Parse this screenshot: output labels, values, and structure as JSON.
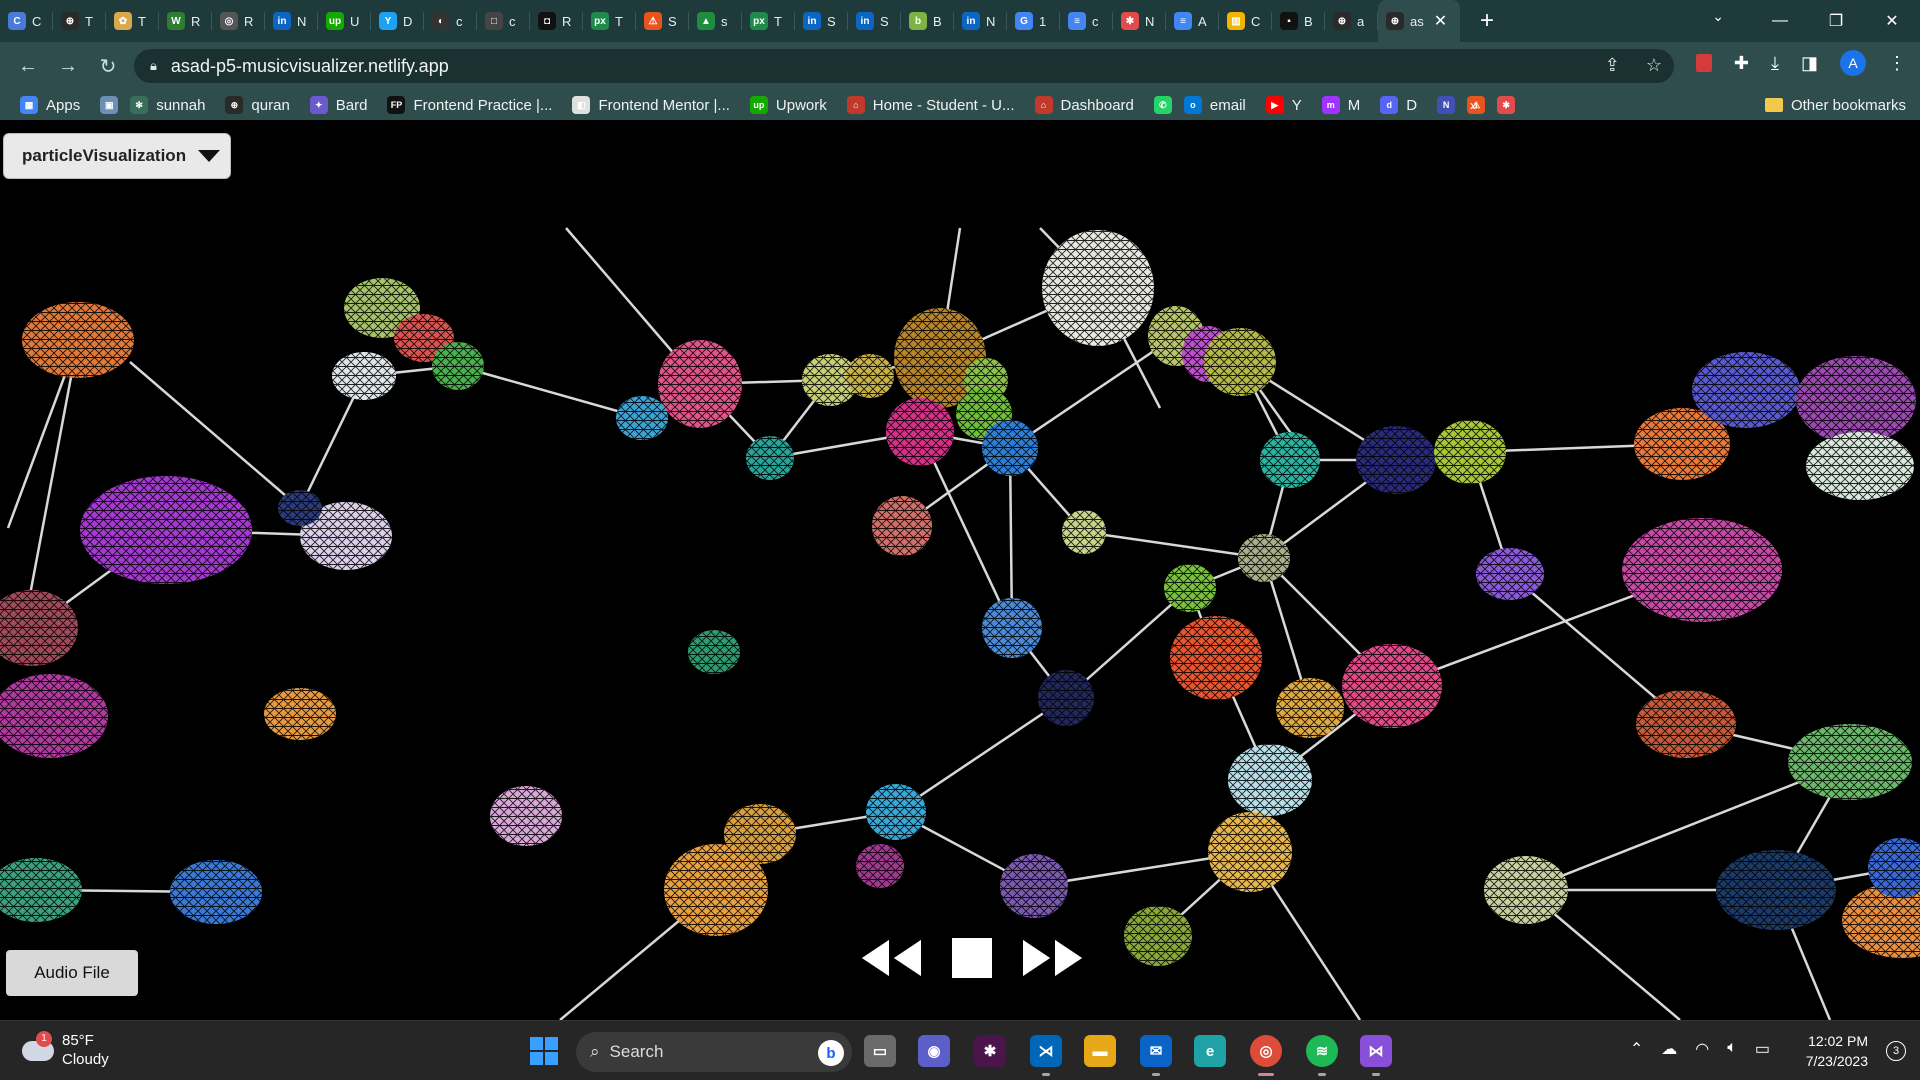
{
  "browser": {
    "tabs": [
      {
        "icon": "C",
        "label": "C",
        "color": "#4a7bd9"
      },
      {
        "icon": "⊕",
        "label": "T",
        "color": "#2a2a2a"
      },
      {
        "icon": "✿",
        "label": "T",
        "color": "#d9a84a"
      },
      {
        "icon": "W",
        "label": "R",
        "color": "#2e7d32"
      },
      {
        "icon": "◎",
        "label": "R",
        "color": "#555"
      },
      {
        "icon": "in",
        "label": "N",
        "color": "#0a66c2"
      },
      {
        "icon": "up",
        "label": "U",
        "color": "#14a800"
      },
      {
        "icon": "Y",
        "label": "D",
        "color": "#1da1f2"
      },
      {
        "icon": "◐",
        "label": "c",
        "color": "#333"
      },
      {
        "icon": "□",
        "label": "c",
        "color": "#444"
      },
      {
        "icon": "◘",
        "label": "R",
        "color": "#111"
      },
      {
        "icon": "px",
        "label": "T",
        "color": "#1f8a4c"
      },
      {
        "icon": "⚠",
        "label": "S",
        "color": "#e8541c"
      },
      {
        "icon": "▲",
        "label": "s",
        "color": "#1e8e3e"
      },
      {
        "icon": "px",
        "label": "T",
        "color": "#1f8a4c"
      },
      {
        "icon": "in",
        "label": "S",
        "color": "#0a66c2"
      },
      {
        "icon": "in",
        "label": "S",
        "color": "#0a66c2"
      },
      {
        "icon": "b",
        "label": "B",
        "color": "#7cb342"
      },
      {
        "icon": "in",
        "label": "N",
        "color": "#0a66c2"
      },
      {
        "icon": "G",
        "label": "1",
        "color": "#4285f4"
      },
      {
        "icon": "≡",
        "label": "c",
        "color": "#4285f4"
      },
      {
        "icon": "✱",
        "label": "N",
        "color": "#e24b4b"
      },
      {
        "icon": "≡",
        "label": "A",
        "color": "#4285f4"
      },
      {
        "icon": "▥",
        "label": "C",
        "color": "#f2b400"
      },
      {
        "icon": "▪",
        "label": "B",
        "color": "#111"
      },
      {
        "icon": "⊕",
        "label": "a",
        "color": "#2a2a2a"
      }
    ],
    "active_tab": {
      "icon": "⊕",
      "label": "as",
      "color": "#2a2a2a"
    },
    "url": "asad-p5-musicvisualizer.netlify.app",
    "profile_initial": "A"
  },
  "bookmarks": {
    "items": [
      {
        "icon": "▦",
        "label": "Apps",
        "color": "#4285f4"
      },
      {
        "icon": "▣",
        "label": "",
        "color": "#6b8fb5"
      },
      {
        "icon": "✻",
        "label": "sunnah",
        "color": "#3b6e5a"
      },
      {
        "icon": "⊕",
        "label": "quran",
        "color": "#2a2a2a"
      },
      {
        "icon": "✦",
        "label": "Bard",
        "color": "#6a5acd"
      },
      {
        "icon": "FP",
        "label": "Frontend Practice |...",
        "color": "#111"
      },
      {
        "icon": "◧",
        "label": "Frontend Mentor |...",
        "color": "#e0e0e0"
      },
      {
        "icon": "up",
        "label": "Upwork",
        "color": "#14a800"
      },
      {
        "icon": "⌂",
        "label": "Home - Student - U...",
        "color": "#c0392b"
      },
      {
        "icon": "⌂",
        "label": "Dashboard",
        "color": "#c0392b"
      },
      {
        "icon": "✆",
        "label": "",
        "color": "#25d366"
      },
      {
        "icon": "o",
        "label": "email",
        "color": "#0078d4"
      },
      {
        "icon": "▶",
        "label": "Y",
        "color": "#ff0000"
      },
      {
        "icon": "m",
        "label": "M",
        "color": "#a033ff"
      },
      {
        "icon": "d",
        "label": "D",
        "color": "#5865f2"
      },
      {
        "icon": "N",
        "label": "",
        "color": "#3f51b5"
      },
      {
        "icon": "⚠",
        "label": "",
        "color": "#e8541c"
      },
      {
        "icon": "✱",
        "label": "",
        "color": "#e24b4b"
      }
    ],
    "more": "»",
    "other": "Other bookmarks"
  },
  "app": {
    "mode_select": "particleVisualization",
    "audio_button": "Audio File"
  },
  "taskbar": {
    "weather_temp": "85°F",
    "weather_desc": "Cloudy",
    "weather_badge": "1",
    "search_label": "Search",
    "time": "12:02 PM",
    "date": "7/23/2023",
    "notifications": "3"
  }
}
